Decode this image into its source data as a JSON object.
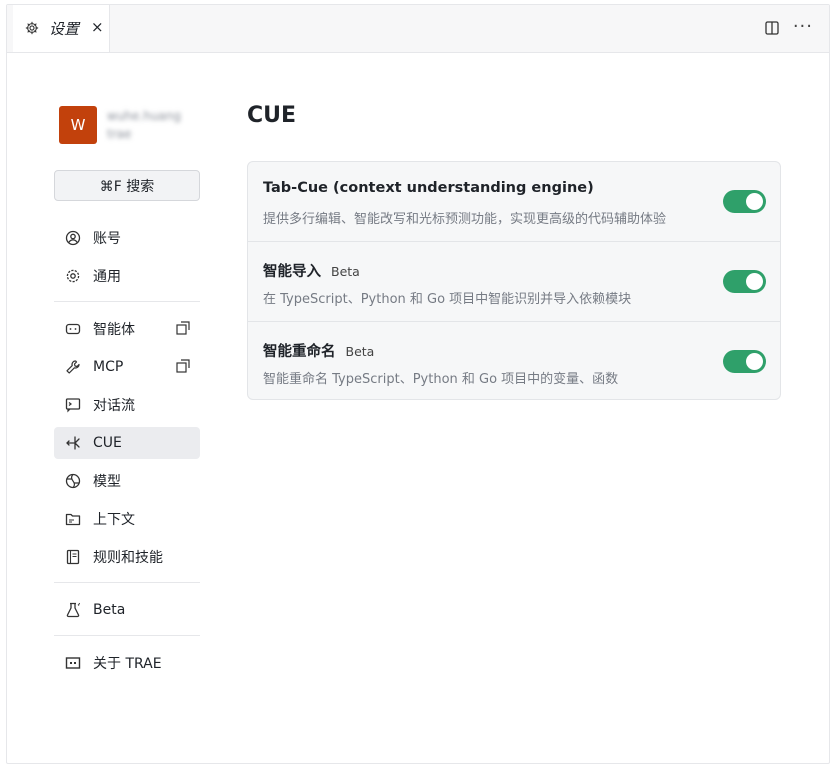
{
  "tab": {
    "title": "设置",
    "close": "×"
  },
  "toolbar": {
    "more": "···"
  },
  "user": {
    "avatar_letter": "W",
    "name_line1": "wuhe.huang",
    "name_line2": "trae"
  },
  "search": {
    "label": "⌘F 搜索"
  },
  "nav": {
    "account": "账号",
    "general": "通用",
    "agents": "智能体",
    "mcp": "MCP",
    "flow": "对话流",
    "cue": "CUE",
    "models": "模型",
    "context": "上下文",
    "rules": "规则和技能",
    "beta": "Beta",
    "about": "关于 TRAE"
  },
  "main": {
    "title": "CUE",
    "settings": [
      {
        "title": "Tab-Cue (context understanding engine)",
        "badge": "",
        "desc": "提供多行编辑、智能改写和光标预测功能，实现更高级的代码辅助体验",
        "enabled": true
      },
      {
        "title": "智能导入",
        "badge": "Beta",
        "desc": "在 TypeScript、Python 和 Go 项目中智能识别并导入依赖模块",
        "enabled": true
      },
      {
        "title": "智能重命名",
        "badge": "Beta",
        "desc": "智能重命名 TypeScript、Python 和 Go 项目中的变量、函数",
        "enabled": true
      }
    ]
  },
  "colors": {
    "accent": "#2fa06a",
    "avatar": "#c2410c"
  }
}
